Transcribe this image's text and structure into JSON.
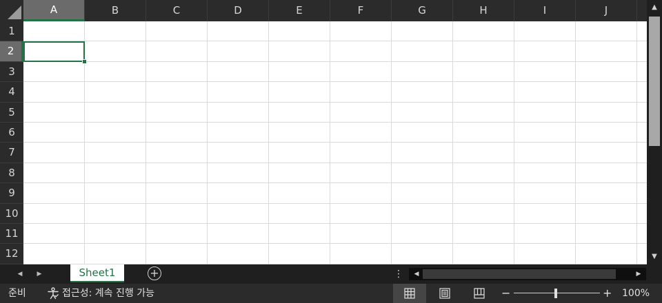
{
  "grid": {
    "columns": [
      "A",
      "B",
      "C",
      "D",
      "E",
      "F",
      "G",
      "H",
      "I",
      "J"
    ],
    "rows": [
      "1",
      "2",
      "3",
      "4",
      "5",
      "6",
      "7",
      "8",
      "9",
      "10",
      "11",
      "12"
    ],
    "active_cell": "A2"
  },
  "scrollbar": {
    "up_icon": "triangle-up-icon",
    "down_icon": "triangle-down-icon",
    "left_icon": "triangle-left-icon",
    "right_icon": "triangle-right-icon"
  },
  "sheet_tabs": {
    "tabs": [
      {
        "label": "Sheet1",
        "active": true
      }
    ],
    "add_icon": "plus-circle-icon",
    "prev_icon": "chevron-left-icon",
    "next_icon": "chevron-right-icon",
    "split_icon": "vertical-dots-icon"
  },
  "status_bar": {
    "ready": "준비",
    "accessibility": "접근성: 계속 진행 가능",
    "accessibility_icon": "accessibility-icon",
    "views": [
      {
        "name": "normal-view",
        "icon": "grid-icon",
        "active": true
      },
      {
        "name": "page-layout-view",
        "icon": "page-icon",
        "active": false
      },
      {
        "name": "page-break-view",
        "icon": "page-break-icon",
        "active": false
      }
    ],
    "zoom_out": "−",
    "zoom_in": "+",
    "zoom_level": "100%",
    "zoom_percent": 100
  },
  "colors": {
    "accent": "#217346",
    "header_bg": "#2b2b2b",
    "selected_header_bg": "#6b6b6b",
    "gridline": "#dadada"
  }
}
